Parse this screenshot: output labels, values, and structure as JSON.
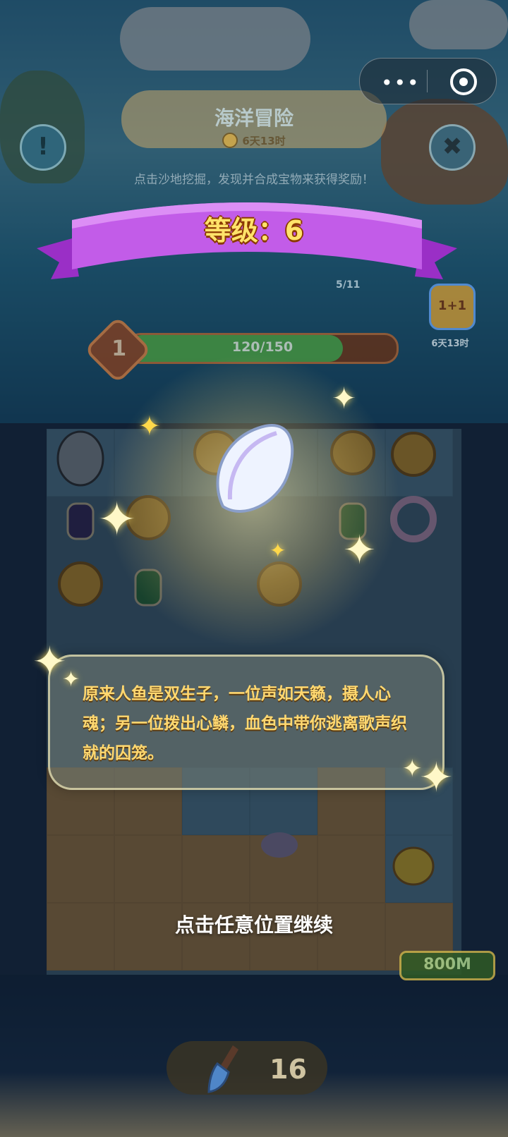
{
  "top_capsule": {
    "more": "•••",
    "target_icon": "target-icon"
  },
  "event": {
    "title": "海洋冒险",
    "timer": "6天13时",
    "hint": "点击沙地挖掘，发现并合成宝物来获得奖励！"
  },
  "buttons": {
    "info_icon": "exclamation-icon",
    "close_icon": "close-icon",
    "info_symbol": "!",
    "close_symbol": "✖"
  },
  "level_popup": {
    "title": "等级：6"
  },
  "progress": {
    "level": "1",
    "label": "120/150",
    "fraction": 0.8
  },
  "collection_counter": "5/11",
  "side_event": {
    "badge": "1+1",
    "timer": "6天13时"
  },
  "reward_item": {
    "icon": "pearl-shell-petal-icon"
  },
  "story": {
    "text": "原来人鱼是双生子，一位声如天籁，摄人心魂；另一位拨出心鳞，血色中带你逃离歌声织就的囚笼。"
  },
  "continue_prompt": "点击任意位置继续",
  "depth": "800M",
  "shovel": {
    "count": "16",
    "icon": "shovel-icon"
  },
  "colors": {
    "level_text": "#ffe36a",
    "story_text": "#ffd870",
    "ribbon": "#b84de0"
  }
}
